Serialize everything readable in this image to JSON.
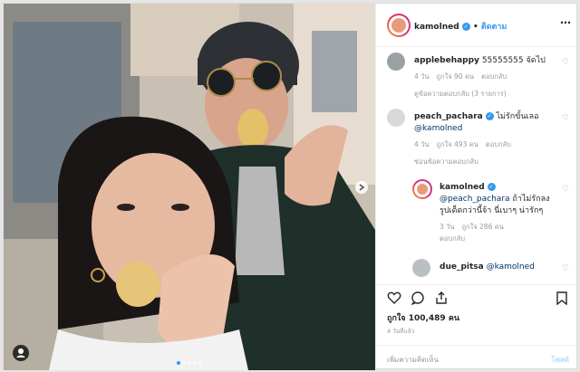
{
  "post": {
    "username": "kamolned",
    "follow_label": "ติดตาม",
    "carousel": {
      "total": 5,
      "active": 1
    }
  },
  "comments": [
    {
      "username": "applebehappy",
      "text": "55555555 จัดไป",
      "time": "4 วัน",
      "likes": "ถูกใจ 90 คน",
      "reply": "ตอบกลับ",
      "view_replies": "ดูข้อความตอบกลับ (3 รายการ)"
    },
    {
      "username": "peach_pachara",
      "text": "ไม่รักขั้นเลอ",
      "mention": "@kamolned",
      "time": "4 วัน",
      "likes": "ถูกใจ 493 คน",
      "reply": "ตอบกลับ",
      "view_replies": "ซ่อนข้อความตอบกลับ"
    },
    {
      "username": "kamolned",
      "mention": "@peach_pachara",
      "text": "ถ้าไม่รักลงรูปเด็ดกว่านี้จ้า นี่เบาๆ น่ารักๆ",
      "time": "3 วัน",
      "likes": "ถูกใจ 286 คน",
      "reply": "ตอบกลับ"
    },
    {
      "username": "due_pitsa",
      "mention": "@kamolned"
    }
  ],
  "footer": {
    "likes": "ถูกใจ 100,489 คน",
    "posted": "4 วันที่แล้ว",
    "comment_placeholder": "เพิ่มความคิดเห็น",
    "post_label": "โพสต์"
  },
  "colors": {
    "accent": "#3897f0",
    "verified": "#3897f0",
    "muted": "#999999"
  },
  "icons": [
    "user-tag-icon",
    "chevron-right-icon",
    "heart-icon",
    "comment-icon",
    "share-icon",
    "bookmark-icon",
    "more-icon",
    "verified-icon"
  ]
}
